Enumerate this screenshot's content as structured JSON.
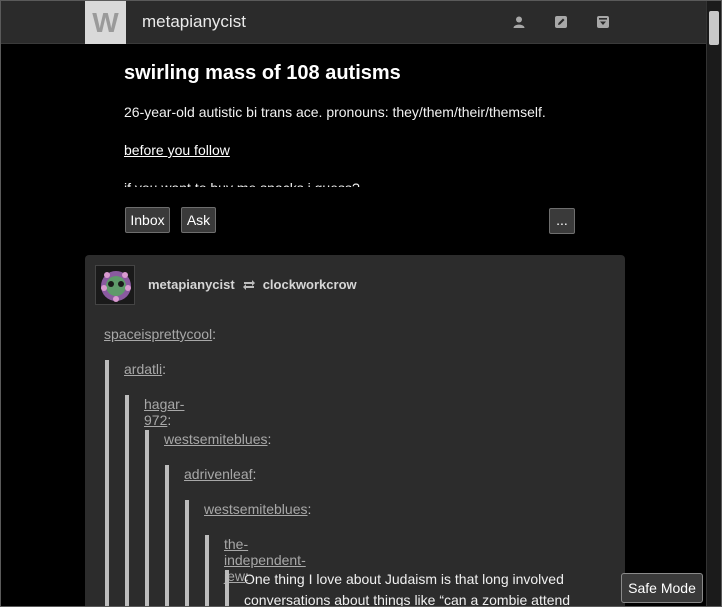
{
  "header": {
    "logo_letter": "W",
    "blog_name": "metapianycist",
    "icons": [
      "user-icon",
      "edit-icon",
      "archive-icon"
    ]
  },
  "blog": {
    "title": "swirling mass of 108 autisms",
    "bio": "26-year-old autistic bi trans ace. pronouns: they/them/their/themself.",
    "follow_link": "before you follow",
    "extra_line": "if you want to buy me snacks i guess?"
  },
  "buttons": {
    "inbox": "Inbox",
    "ask": "Ask",
    "more": "..."
  },
  "post": {
    "author": "metapianycist",
    "reblogged_from": "clockworkcrow",
    "chain": [
      {
        "user": "spaceisprettycool",
        "suffix": ":"
      },
      {
        "user": "ardatli",
        "suffix": ":"
      },
      {
        "user": "hagar-972",
        "suffix": ":"
      },
      {
        "user": "westsemiteblues",
        "suffix": ":"
      },
      {
        "user": "adrivenleaf",
        "suffix": ":"
      },
      {
        "user": "westsemiteblues",
        "suffix": ":"
      },
      {
        "user": "the-independent-jew",
        "suffix": ":"
      }
    ],
    "body": "One thing I love about Judaism is that long involved conversations about things like “can a zombie attend"
  },
  "safe_mode": "Safe Mode",
  "colors": {
    "page_bg": "#000000",
    "header_bg": "#2b2b2b",
    "post_bg": "#2c2c2c",
    "quote_bar": "#bdbdbd"
  }
}
